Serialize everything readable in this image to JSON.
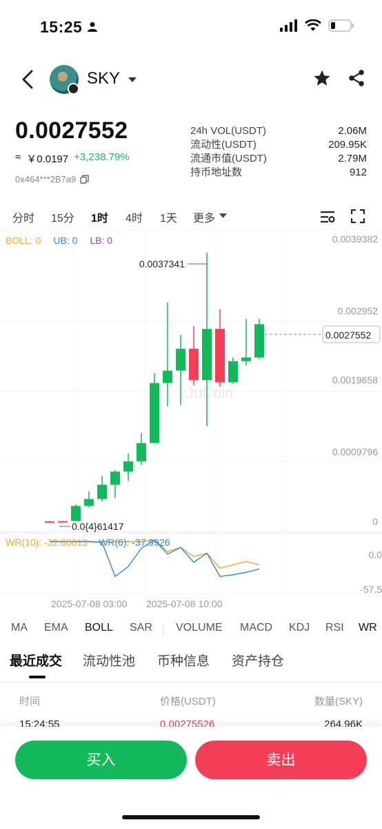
{
  "status_bar": {
    "time": "15:25"
  },
  "header": {
    "token_name": "SKY"
  },
  "price": {
    "main": "0.0027552",
    "approx_symbol": "≈",
    "cny": "￥0.0197",
    "change": "+3,238.79%",
    "contract": "0x464***2B7a9"
  },
  "stats": [
    {
      "label": "24h VOL(USDT)",
      "value": "2.06M"
    },
    {
      "label": "流动性(USDT)",
      "value": "209.95K"
    },
    {
      "label": "流通市值(USDT)",
      "value": "2.79M"
    },
    {
      "label": "持币地址数",
      "value": "912"
    }
  ],
  "timeframes": [
    "分时",
    "15分",
    "1时",
    "4时",
    "1天",
    "更多"
  ],
  "active_timeframe": "1时",
  "boll_legend": {
    "boll": "BOLL: 0",
    "ub": "UB: 0",
    "lb": "LB: 0"
  },
  "wr_legend": {
    "wr10": "WR(10): -32.86013",
    "wr6": "WR(6): -37.9926"
  },
  "indicator_tabs": [
    "MA",
    "EMA",
    "BOLL",
    "SAR",
    "VOLUME",
    "MACD",
    "KDJ",
    "RSI",
    "WR"
  ],
  "section_tabs": [
    "最近成交",
    "流动性池",
    "币种信息",
    "资产持仓"
  ],
  "trade_table": {
    "headers": [
      "时间",
      "价格(USDT)",
      "数量(SKY)"
    ],
    "rows": [
      {
        "time": "15:24:55",
        "price": "0.00275526",
        "amount": "264.96K"
      }
    ]
  },
  "buttons": {
    "buy": "买入",
    "sell": "卖出"
  },
  "colors": {
    "up": "#14b95c",
    "down": "#f43d56",
    "boll": "#f5a623",
    "ub": "#2e86de",
    "lb": "#8e44ad"
  },
  "chart_data": [
    {
      "type": "candlestick",
      "y_ticks": [
        "0.0039382",
        "0.002952",
        "0.0019658",
        "0.0009796",
        "0"
      ],
      "ylim": [
        0,
        0.0039382
      ],
      "x_tick_labels": [
        "2025-07-08 03:00",
        "2025-07-08 10:00"
      ],
      "max_label": "0.0037341",
      "min_label": "0.0{4}61417",
      "current_price_label": "0.0027552",
      "watermark": "JuCoin",
      "candles": [
        {
          "o": 6e-05,
          "c": 5.9e-05,
          "h": 6.5e-05,
          "l": 5.5e-05
        },
        {
          "o": 6.2e-05,
          "c": 6.1e-05,
          "h": 6.6e-05,
          "l": 5.8e-05
        },
        {
          "o": 6.5e-05,
          "c": 0.00027,
          "h": 0.00029,
          "l": 6e-05
        },
        {
          "o": 0.00027,
          "c": 0.000365,
          "h": 0.00047,
          "l": 0.00025
        },
        {
          "o": 0.000365,
          "c": 0.00056,
          "h": 0.00068,
          "l": 0.00033
        },
        {
          "o": 0.00056,
          "c": 0.00074,
          "h": 0.00076,
          "l": 0.00038
        },
        {
          "o": 0.00074,
          "c": 0.00088,
          "h": 0.00099,
          "l": 0.00061
        },
        {
          "o": 0.00088,
          "c": 0.00113,
          "h": 0.00127,
          "l": 0.00083
        },
        {
          "o": 0.00113,
          "c": 0.00195,
          "h": 0.00209,
          "l": 0.00113
        },
        {
          "o": 0.00195,
          "c": 0.00212,
          "h": 0.00305,
          "l": 0.00163
        },
        {
          "o": 0.00212,
          "c": 0.00242,
          "h": 0.00261,
          "l": 0.00165
        },
        {
          "o": 0.00242,
          "c": 0.00199,
          "h": 0.00273,
          "l": 0.00192
        },
        {
          "o": 0.00199,
          "c": 0.00269,
          "h": 0.0037341,
          "l": 0.00136
        },
        {
          "o": 0.00269,
          "c": 0.00196,
          "h": 0.00296,
          "l": 0.0019
        },
        {
          "o": 0.00196,
          "c": 0.00225,
          "h": 0.0023,
          "l": 0.00194
        },
        {
          "o": 0.00225,
          "c": 0.0023,
          "h": 0.00283,
          "l": 0.00219
        },
        {
          "o": 0.0023,
          "c": 0.0027552,
          "h": 0.00283,
          "l": 0.00228
        }
      ]
    },
    {
      "type": "line",
      "title": "WR",
      "y_ticks": [
        "0.0",
        "-57.5"
      ],
      "ylim": [
        -70,
        0
      ],
      "series": [
        {
          "name": "WR(10)",
          "color": "#f5a623",
          "values": [
            -5,
            -5,
            -5,
            -5,
            -5,
            -5,
            -5,
            -5,
            -3,
            -17,
            -12,
            -23,
            -19,
            -37,
            -33,
            -29,
            -33
          ]
        },
        {
          "name": "WR(6)",
          "color": "#2e86de",
          "values": [
            -5,
            -5,
            -5,
            -5,
            -6,
            -47,
            -35,
            -13,
            -3,
            -20,
            -12,
            -30,
            -19,
            -47,
            -45,
            -42,
            -38
          ]
        }
      ]
    }
  ]
}
